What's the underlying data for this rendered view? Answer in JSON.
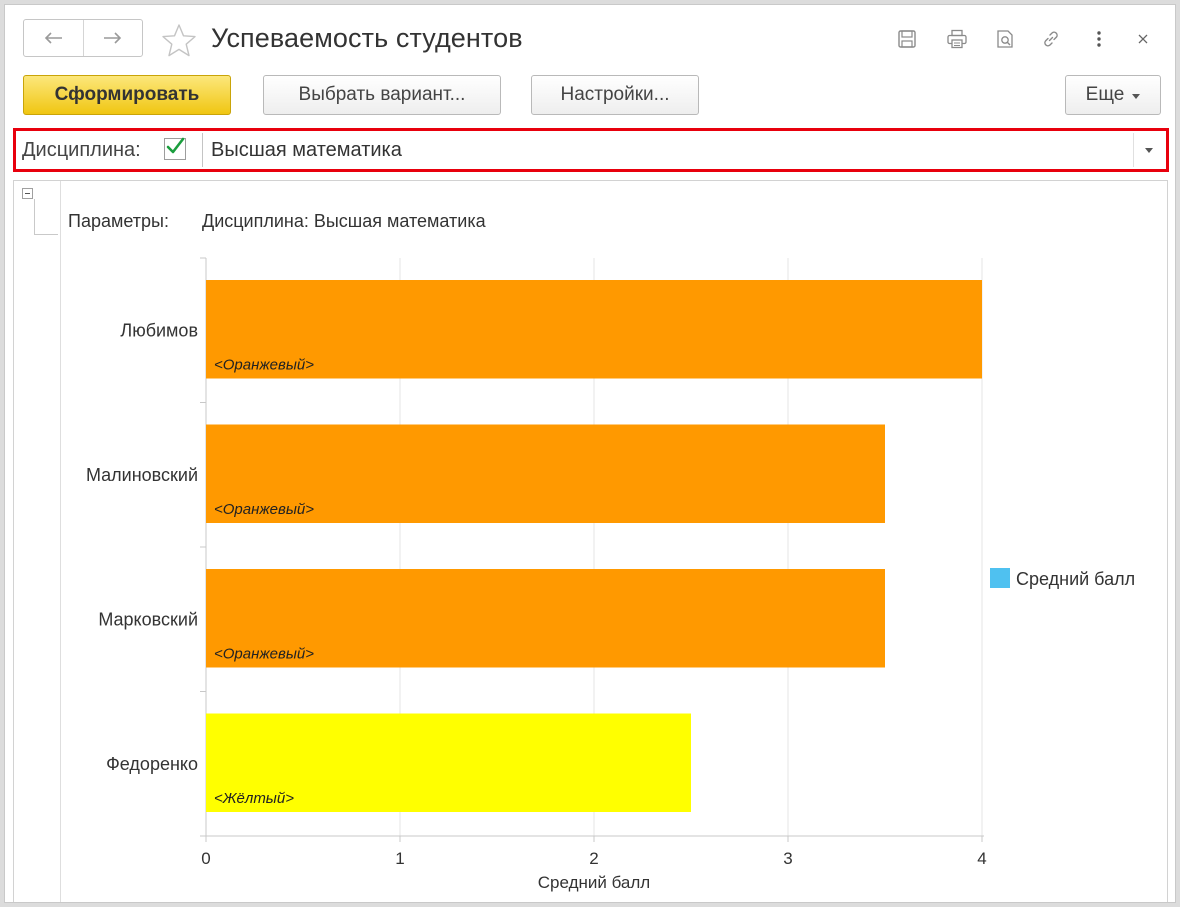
{
  "window": {
    "title": "Успеваемость студентов"
  },
  "toolbar": {
    "generate_label": "Сформировать",
    "choose_variant_label": "Выбрать вариант...",
    "settings_label": "Настройки...",
    "more_label": "Еще"
  },
  "filter": {
    "label": "Дисциплина:",
    "checked": true,
    "value": "Высшая математика"
  },
  "report": {
    "params_label": "Параметры:",
    "params_value": "Дисциплина: Высшая математика"
  },
  "colors": {
    "orange": "#ff9900",
    "yellow": "#ffff00",
    "legend_swatch": "#4fc1f0",
    "primary_button": "#f4d12c",
    "filter_highlight": "#e8000d",
    "check": "#1b9e3e"
  },
  "chart_data": {
    "type": "bar",
    "orientation": "horizontal",
    "categories": [
      "Любимов",
      "Малиновский",
      "Марковский",
      "Федоренко"
    ],
    "series": [
      {
        "name": "Средний балл",
        "values": [
          4,
          3.5,
          3.5,
          2.5
        ]
      }
    ],
    "bar_colors": [
      "#ff9900",
      "#ff9900",
      "#ff9900",
      "#ffff00"
    ],
    "bar_labels": [
      "<Оранжевый>",
      "<Оранжевый>",
      "<Оранжевый>",
      "<Жёлтый>"
    ],
    "xlabel": "Средний балл",
    "xlim": [
      0,
      4
    ],
    "xticks": [
      "0",
      "1",
      "2",
      "3",
      "4"
    ],
    "grid": true,
    "legend": {
      "position": "right",
      "entries": [
        "Средний балл"
      ]
    }
  }
}
